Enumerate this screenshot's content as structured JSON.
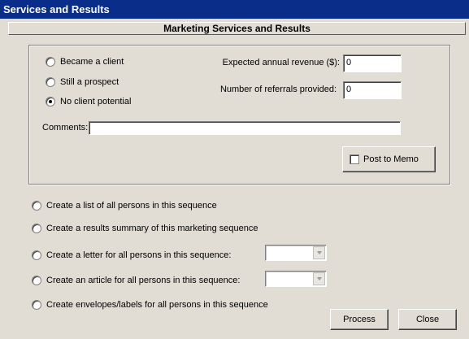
{
  "window": {
    "title": "Services and Results"
  },
  "section": {
    "title": "Marketing Services and Results"
  },
  "status_options": [
    {
      "label": "Became a client",
      "checked": false
    },
    {
      "label": "Still a prospect",
      "checked": false
    },
    {
      "label": "No client potential",
      "checked": true
    }
  ],
  "fields": {
    "revenue_label": "Expected annual revenue ($):",
    "revenue_value": "0",
    "referrals_label": "Number of referrals provided:",
    "referrals_value": "0",
    "comments_label": "Comments:",
    "comments_value": ""
  },
  "post_to_memo": {
    "label": "Post to Memo",
    "checked": false
  },
  "actions": [
    {
      "label": "Create a list of all persons in this sequence",
      "has_dropdown": false,
      "dropdown_value": ""
    },
    {
      "label": "Create a results summary of this marketing sequence",
      "has_dropdown": false,
      "dropdown_value": ""
    },
    {
      "label": "Create a letter for all persons in this sequence:",
      "has_dropdown": true,
      "dropdown_value": ""
    },
    {
      "label": "Create an article for all persons in this sequence:",
      "has_dropdown": true,
      "dropdown_value": ""
    },
    {
      "label": "Create envelopes/labels for all persons in this sequence",
      "has_dropdown": false,
      "dropdown_value": ""
    }
  ],
  "buttons": {
    "process": "Process",
    "close": "Close"
  },
  "colors": {
    "title_bar": "#0a2d8a",
    "dialog_bg": "#e1ddd5"
  }
}
